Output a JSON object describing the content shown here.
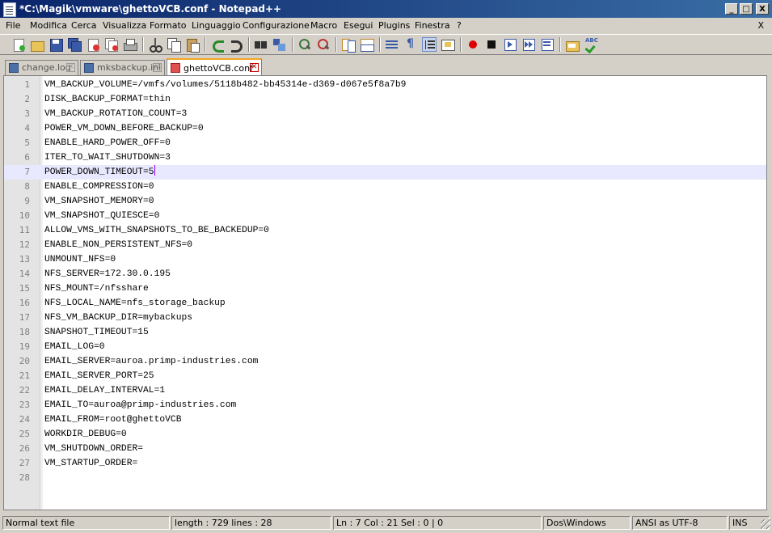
{
  "window": {
    "title": "*C:\\Magik\\vmware\\ghettoVCB.conf - Notepad++",
    "minimize": "_",
    "restore": "□",
    "close": "X"
  },
  "menu": {
    "items": [
      "File",
      "Modifica",
      "Cerca",
      "Visualizza",
      "Formato",
      "Linguaggio",
      "Configurazione",
      "Macro",
      "Esegui",
      "Plugins",
      "Finestra",
      "?"
    ],
    "close_doc": "X"
  },
  "toolbar": {
    "buttons": [
      "new",
      "open",
      "save",
      "save-all",
      "close",
      "close-all",
      "print",
      "cut",
      "copy",
      "paste",
      "undo",
      "redo",
      "find",
      "replace",
      "zoom-in",
      "zoom-out",
      "sync-vertical",
      "sync-horizontal",
      "word-wrap",
      "show-all-chars",
      "indent-guide",
      "user-defined-lang",
      "record-macro",
      "stop-record",
      "play-macro",
      "run-macro-multiple",
      "save-macro",
      "open-folder",
      "spell-check"
    ]
  },
  "tabs": [
    {
      "label": "change.log",
      "active": false
    },
    {
      "label": "mksbackup.ini",
      "active": false
    },
    {
      "label": "ghettoVCB.conf",
      "active": true
    }
  ],
  "editor": {
    "current_line": 7,
    "lines": [
      "VM_BACKUP_VOLUME=/vmfs/volumes/5118b482-bb45314e-d369-d067e5f8a7b9",
      "DISK_BACKUP_FORMAT=thin",
      "VM_BACKUP_ROTATION_COUNT=3",
      "POWER_VM_DOWN_BEFORE_BACKUP=0",
      "ENABLE_HARD_POWER_OFF=0",
      "ITER_TO_WAIT_SHUTDOWN=3",
      "POWER_DOWN_TIMEOUT=5",
      "ENABLE_COMPRESSION=0",
      "VM_SNAPSHOT_MEMORY=0",
      "VM_SNAPSHOT_QUIESCE=0",
      "ALLOW_VMS_WITH_SNAPSHOTS_TO_BE_BACKEDUP=0",
      "ENABLE_NON_PERSISTENT_NFS=0",
      "UNMOUNT_NFS=0",
      "NFS_SERVER=172.30.0.195",
      "NFS_MOUNT=/nfsshare",
      "NFS_LOCAL_NAME=nfs_storage_backup",
      "NFS_VM_BACKUP_DIR=mybackups",
      "SNAPSHOT_TIMEOUT=15",
      "EMAIL_LOG=0",
      "EMAIL_SERVER=auroa.primp-industries.com",
      "EMAIL_SERVER_PORT=25",
      "EMAIL_DELAY_INTERVAL=1",
      "EMAIL_TO=auroa@primp-industries.com",
      "EMAIL_FROM=root@ghettoVCB",
      "WORKDIR_DEBUG=0",
      "VM_SHUTDOWN_ORDER=",
      "VM_STARTUP_ORDER=",
      ""
    ]
  },
  "status": {
    "type": "Normal text file",
    "length": "length : 729    lines : 28",
    "position": "Ln : 7    Col : 21    Sel : 0 | 0",
    "eol": "Dos\\Windows",
    "encoding": "ANSI as UTF-8",
    "mode": "INS"
  }
}
